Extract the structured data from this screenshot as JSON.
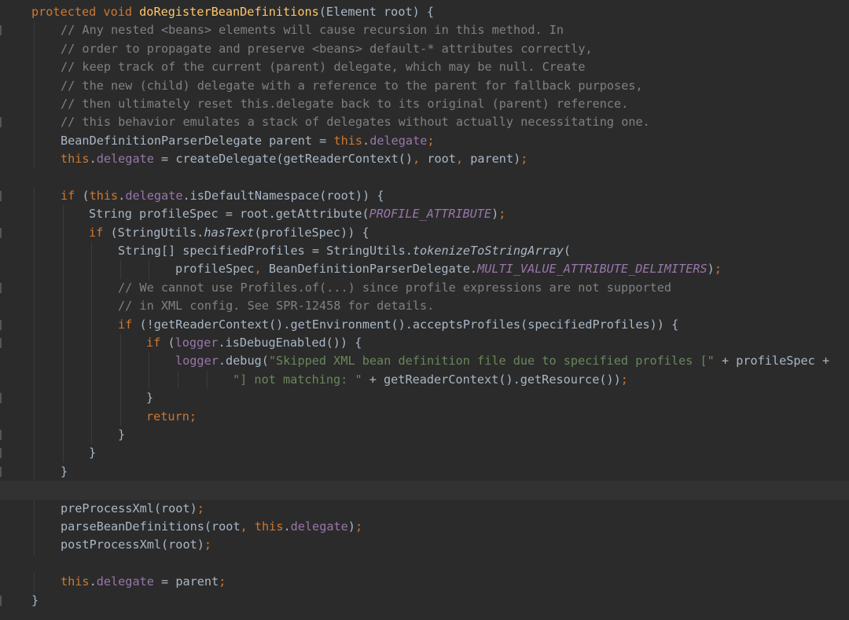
{
  "editor": {
    "theme": {
      "background": "#2b2b2b",
      "plain": "#a9b7c6",
      "keyword": "#cc7832",
      "method_decl": "#ffc66d",
      "comment": "#808080",
      "field": "#9876aa",
      "string": "#6a8759",
      "current_line": "#323232"
    },
    "lines": [
      {
        "indent": 1,
        "gutter": false,
        "tokens": [
          [
            "kw",
            "protected void "
          ],
          [
            "fn",
            "doRegisterBeanDefinitions"
          ],
          [
            "plain",
            "(Element root) {"
          ]
        ]
      },
      {
        "indent": 2,
        "gutter": true,
        "tokens": [
          [
            "cm",
            "// Any nested <beans> elements will cause recursion in this method. In"
          ]
        ]
      },
      {
        "indent": 2,
        "gutter": false,
        "tokens": [
          [
            "cm",
            "// order to propagate and preserve <beans> default-* attributes correctly,"
          ]
        ]
      },
      {
        "indent": 2,
        "gutter": false,
        "tokens": [
          [
            "cm",
            "// keep track of the current (parent) delegate, which may be null. Create"
          ]
        ]
      },
      {
        "indent": 2,
        "gutter": false,
        "tokens": [
          [
            "cm",
            "// the new (child) delegate with a reference to the parent for fallback purposes,"
          ]
        ]
      },
      {
        "indent": 2,
        "gutter": false,
        "tokens": [
          [
            "cm",
            "// then ultimately reset this.delegate back to its original (parent) reference."
          ]
        ]
      },
      {
        "indent": 2,
        "gutter": true,
        "tokens": [
          [
            "cm",
            "// this behavior emulates a stack of delegates without actually necessitating one."
          ]
        ]
      },
      {
        "indent": 2,
        "gutter": false,
        "tokens": [
          [
            "plain",
            "BeanDefinitionParserDelegate parent = "
          ],
          [
            "kw",
            "this"
          ],
          [
            "plain",
            "."
          ],
          [
            "fld",
            "delegate"
          ],
          [
            "kw",
            ";"
          ]
        ]
      },
      {
        "indent": 2,
        "gutter": false,
        "tokens": [
          [
            "kw",
            "this"
          ],
          [
            "plain",
            "."
          ],
          [
            "fld",
            "delegate"
          ],
          [
            "plain",
            " = createDelegate(getReaderContext()"
          ],
          [
            "kw",
            ", "
          ],
          [
            "plain",
            "root"
          ],
          [
            "kw",
            ", "
          ],
          [
            "plain",
            "parent)"
          ],
          [
            "kw",
            ";"
          ]
        ]
      },
      {
        "indent": 0,
        "gutter": false,
        "tokens": []
      },
      {
        "indent": 2,
        "gutter": true,
        "tokens": [
          [
            "kw",
            "if "
          ],
          [
            "plain",
            "("
          ],
          [
            "kw",
            "this"
          ],
          [
            "plain",
            "."
          ],
          [
            "fld",
            "delegate"
          ],
          [
            "plain",
            ".isDefaultNamespace(root)) {"
          ]
        ]
      },
      {
        "indent": 3,
        "gutter": false,
        "tokens": [
          [
            "plain",
            "String profileSpec = root.getAttribute("
          ],
          [
            "const",
            "PROFILE_ATTRIBUTE"
          ],
          [
            "plain",
            ")"
          ],
          [
            "kw",
            ";"
          ]
        ]
      },
      {
        "indent": 3,
        "gutter": true,
        "tokens": [
          [
            "kw",
            "if "
          ],
          [
            "plain",
            "(StringUtils."
          ],
          [
            "static",
            "hasText"
          ],
          [
            "plain",
            "(profileSpec)) {"
          ]
        ]
      },
      {
        "indent": 4,
        "gutter": false,
        "tokens": [
          [
            "plain",
            "String[] specifiedProfiles = StringUtils."
          ],
          [
            "static",
            "tokenizeToStringArray"
          ],
          [
            "plain",
            "("
          ]
        ]
      },
      {
        "indent": 6,
        "gutter": false,
        "tokens": [
          [
            "plain",
            "profileSpec"
          ],
          [
            "kw",
            ", "
          ],
          [
            "plain",
            "BeanDefinitionParserDelegate."
          ],
          [
            "const",
            "MULTI_VALUE_ATTRIBUTE_DELIMITERS"
          ],
          [
            "plain",
            ")"
          ],
          [
            "kw",
            ";"
          ]
        ]
      },
      {
        "indent": 4,
        "gutter": true,
        "tokens": [
          [
            "cm",
            "// We cannot use Profiles.of(...) since profile expressions are not supported"
          ]
        ]
      },
      {
        "indent": 4,
        "gutter": false,
        "tokens": [
          [
            "cm",
            "// in XML config. See SPR-12458 for details."
          ]
        ]
      },
      {
        "indent": 4,
        "gutter": true,
        "tokens": [
          [
            "kw",
            "if "
          ],
          [
            "plain",
            "(!getReaderContext().getEnvironment().acceptsProfiles(specifiedProfiles)) {"
          ]
        ]
      },
      {
        "indent": 5,
        "gutter": true,
        "tokens": [
          [
            "kw",
            "if "
          ],
          [
            "plain",
            "("
          ],
          [
            "fld",
            "logger"
          ],
          [
            "plain",
            ".isDebugEnabled()) {"
          ]
        ]
      },
      {
        "indent": 6,
        "gutter": false,
        "tokens": [
          [
            "fld",
            "logger"
          ],
          [
            "plain",
            ".debug("
          ],
          [
            "str",
            "\"Skipped XML bean definition file due to specified profiles [\""
          ],
          [
            "plain",
            " + profileSpec +"
          ]
        ]
      },
      {
        "indent": 8,
        "gutter": false,
        "tokens": [
          [
            "str",
            "\"] not matching: \""
          ],
          [
            "plain",
            " + getReaderContext().getResource())"
          ],
          [
            "kw",
            ";"
          ]
        ]
      },
      {
        "indent": 5,
        "gutter": true,
        "tokens": [
          [
            "plain",
            "}"
          ]
        ]
      },
      {
        "indent": 5,
        "gutter": false,
        "tokens": [
          [
            "kw",
            "return;"
          ]
        ]
      },
      {
        "indent": 4,
        "gutter": true,
        "tokens": [
          [
            "plain",
            "}"
          ]
        ]
      },
      {
        "indent": 3,
        "gutter": true,
        "tokens": [
          [
            "plain",
            "}"
          ]
        ]
      },
      {
        "indent": 2,
        "gutter": true,
        "tokens": [
          [
            "plain",
            "}"
          ]
        ]
      },
      {
        "indent": 0,
        "gutter": false,
        "current": true,
        "tokens": []
      },
      {
        "indent": 2,
        "gutter": false,
        "tokens": [
          [
            "plain",
            "preProcessXml(root)"
          ],
          [
            "kw",
            ";"
          ]
        ]
      },
      {
        "indent": 2,
        "gutter": false,
        "tokens": [
          [
            "plain",
            "parseBeanDefinitions(root"
          ],
          [
            "kw",
            ", "
          ],
          [
            "kw",
            "this"
          ],
          [
            "plain",
            "."
          ],
          [
            "fld",
            "delegate"
          ],
          [
            "plain",
            ")"
          ],
          [
            "kw",
            ";"
          ]
        ]
      },
      {
        "indent": 2,
        "gutter": false,
        "tokens": [
          [
            "plain",
            "postProcessXml(root)"
          ],
          [
            "kw",
            ";"
          ]
        ]
      },
      {
        "indent": 0,
        "gutter": false,
        "tokens": []
      },
      {
        "indent": 2,
        "gutter": false,
        "tokens": [
          [
            "kw",
            "this"
          ],
          [
            "plain",
            "."
          ],
          [
            "fld",
            "delegate"
          ],
          [
            "plain",
            " = parent"
          ],
          [
            "kw",
            ";"
          ]
        ]
      },
      {
        "indent": 1,
        "gutter": true,
        "tokens": [
          [
            "plain",
            "}"
          ]
        ]
      }
    ]
  }
}
